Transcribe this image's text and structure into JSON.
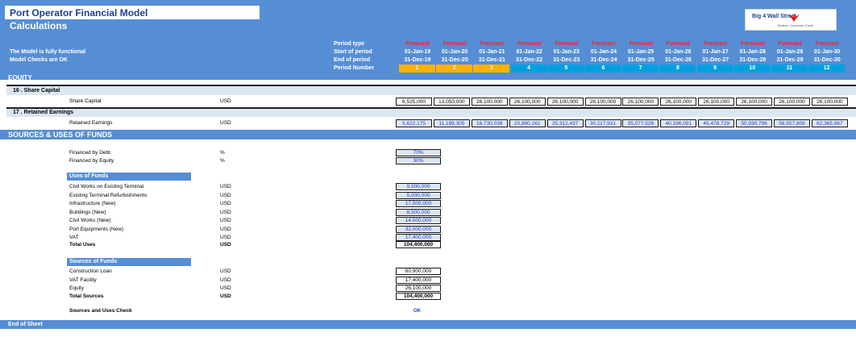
{
  "header": {
    "title": "Port Operator Financial Model",
    "subtitle": "Calculations",
    "notes": [
      "The Model is fully functional",
      "Model Checks are OK"
    ],
    "row_labels": [
      "Period type",
      "Start of period",
      "End of period",
      "Period Number"
    ],
    "logo": {
      "text": "Big 4 Wall Street",
      "tagline": "Believe, Conceive, Excel",
      "icon": "eagle-icon"
    }
  },
  "periods": [
    {
      "type": "Forecast",
      "start": "01-Jan-19",
      "end": "31-Dec-19",
      "num": "1"
    },
    {
      "type": "Forecast",
      "start": "01-Jan-20",
      "end": "31-Dec-20",
      "num": "2"
    },
    {
      "type": "Forecast",
      "start": "01-Jan-21",
      "end": "31-Dec-21",
      "num": "3"
    },
    {
      "type": "Forecast",
      "start": "01-Jan-22",
      "end": "31-Dec-22",
      "num": "4"
    },
    {
      "type": "Forecast",
      "start": "01-Jan-23",
      "end": "31-Dec-23",
      "num": "5"
    },
    {
      "type": "Forecast",
      "start": "01-Jan-24",
      "end": "31-Dec-24",
      "num": "6"
    },
    {
      "type": "Forecast",
      "start": "01-Jan-25",
      "end": "31-Dec-25",
      "num": "7"
    },
    {
      "type": "Forecast",
      "start": "01-Jan-26",
      "end": "31-Dec-26",
      "num": "8"
    },
    {
      "type": "Forecast",
      "start": "01-Jan-27",
      "end": "31-Dec-27",
      "num": "9"
    },
    {
      "type": "Forecast",
      "start": "01-Jan-28",
      "end": "31-Dec-28",
      "num": "10"
    },
    {
      "type": "Forecast",
      "start": "01-Jan-29",
      "end": "31-Dec-29",
      "num": "11"
    },
    {
      "type": "Forecast",
      "start": "01-Jan-30",
      "end": "31-Dec-30",
      "num": "12"
    }
  ],
  "colors": {
    "header": "#558ED5",
    "construction_period": "#FFB000",
    "operation_period": "#00A0E0",
    "forecast": "#FF2020",
    "input_blue": "#1F3FCC",
    "light_band": "#DCE6F2"
  },
  "equity": {
    "title": "EQUITY",
    "share_capital": {
      "heading": "16 .  Share Capital",
      "label": "Share Capital",
      "unit": "USD",
      "values": [
        "6,525,000",
        "13,050,000",
        "26,100,000",
        "26,100,000",
        "26,100,000",
        "26,100,000",
        "26,100,000",
        "26,100,000",
        "26,100,000",
        "26,100,000",
        "26,100,000",
        "26,100,000"
      ]
    },
    "retained_earnings": {
      "heading": "17 .  Retained Earnings",
      "label": "Retained Earnings",
      "unit": "USD",
      "values": [
        "5,622,175",
        "11,199,305",
        "16,730,039",
        "20,890,261",
        "25,312,437",
        "30,117,931",
        "35,077,526",
        "40,196,091",
        "45,478,729",
        "50,930,796",
        "56,557,909",
        "62,365,967"
      ]
    }
  },
  "sources_uses": {
    "title": "SOURCES & USES OF FUNDS",
    "financing": [
      {
        "label": "Financed by Debt",
        "unit": "%",
        "value": "70%"
      },
      {
        "label": "Financed by Equity",
        "unit": "%",
        "value": "30%"
      }
    ],
    "uses_title": "Uses of Funds",
    "uses": [
      {
        "label": "Civil Works on Existing Terminal",
        "unit": "USD",
        "value": "9,500,000"
      },
      {
        "label": "Existing Terminal Refurbishments",
        "unit": "USD",
        "value": "5,000,000"
      },
      {
        "label": "Infrastructure (New)",
        "unit": "USD",
        "value": "17,500,000"
      },
      {
        "label": "Buildings (New)",
        "unit": "USD",
        "value": "8,500,000"
      },
      {
        "label": "Civil Works (New)",
        "unit": "USD",
        "value": "14,500,000"
      },
      {
        "label": "Port Equipments (New)",
        "unit": "USD",
        "value": "32,000,000"
      },
      {
        "label": "VAT",
        "unit": "USD",
        "value": "17,400,000"
      }
    ],
    "total_uses": {
      "label": "Total Uses",
      "unit": "USD",
      "value": "104,400,000"
    },
    "sources_title": "Sources of Funds",
    "sources": [
      {
        "label": "Construction Loan",
        "unit": "USD",
        "value": "60,900,000"
      },
      {
        "label": "VAT Facility",
        "unit": "USD",
        "value": "17,400,000"
      },
      {
        "label": "Equity",
        "unit": "USD",
        "value": "26,100,000"
      }
    ],
    "total_sources": {
      "label": "Total Sources",
      "unit": "USD",
      "value": "104,400,000"
    },
    "check": {
      "label": "Sources and Uses Check",
      "value": "OK"
    }
  },
  "footer": {
    "label": "End of Sheet"
  }
}
